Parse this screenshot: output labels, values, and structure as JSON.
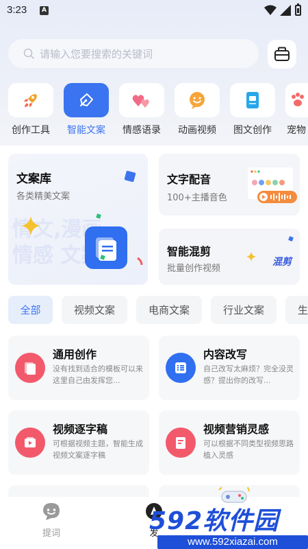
{
  "status_bar": {
    "time": "3:23",
    "notification_letter": "A"
  },
  "search": {
    "placeholder": "请输入您要搜索的关键词"
  },
  "categories": [
    {
      "label": "创作工具",
      "icon": "rocket-icon"
    },
    {
      "label": "智能文案",
      "icon": "pen-nib-icon",
      "active": true
    },
    {
      "label": "情感语录",
      "icon": "hearts-icon"
    },
    {
      "label": "动画视频",
      "icon": "smiley-icon"
    },
    {
      "label": "图文创作",
      "icon": "document-icon"
    },
    {
      "label": "宠物",
      "icon": "paw-icon"
    }
  ],
  "features": {
    "library": {
      "title": "文案库",
      "subtitle": "各类精美文案",
      "watermark_line1": "情文,漫画",
      "watermark_line2": "情感 文案"
    },
    "voiceover": {
      "title": "文字配音",
      "subtitle": "100+主播音色"
    },
    "remix": {
      "title": "智能混剪",
      "subtitle": "批量创作视频",
      "badge": "混剪"
    }
  },
  "filters": [
    "全部",
    "视频文案",
    "电商文案",
    "行业文案",
    "生"
  ],
  "templates": [
    {
      "title": "通用创作",
      "desc": "没有找到适合的模板可以来这里自己由发挥您...",
      "color": "#f25a6b",
      "icon": "document-stack-icon"
    },
    {
      "title": "内容改写",
      "desc": "自己改写太麻烦？完全没灵感？提出你的改写...",
      "color": "#2f6ff0",
      "icon": "list-doc-icon"
    },
    {
      "title": "视频逐字稿",
      "desc": "可根据视频主题，智能生成视频文案逐字稿",
      "color": "#f25a6b",
      "icon": "video-play-icon"
    },
    {
      "title": "视频营销灵感",
      "desc": "可以根据不同类型视频思路植入灵感",
      "color": "#f25a6b",
      "icon": "note-icon"
    }
  ],
  "bottom_nav": [
    {
      "label": "提词",
      "icon": "chat-bubble-icon"
    },
    {
      "label": "发",
      "icon": "publish-icon"
    }
  ],
  "watermark": {
    "brand": "592软件园",
    "url": "www.592xiazai.com"
  },
  "colors": {
    "accent": "#3b74f0",
    "red": "#f25a6b",
    "blue": "#2f6ff0"
  }
}
